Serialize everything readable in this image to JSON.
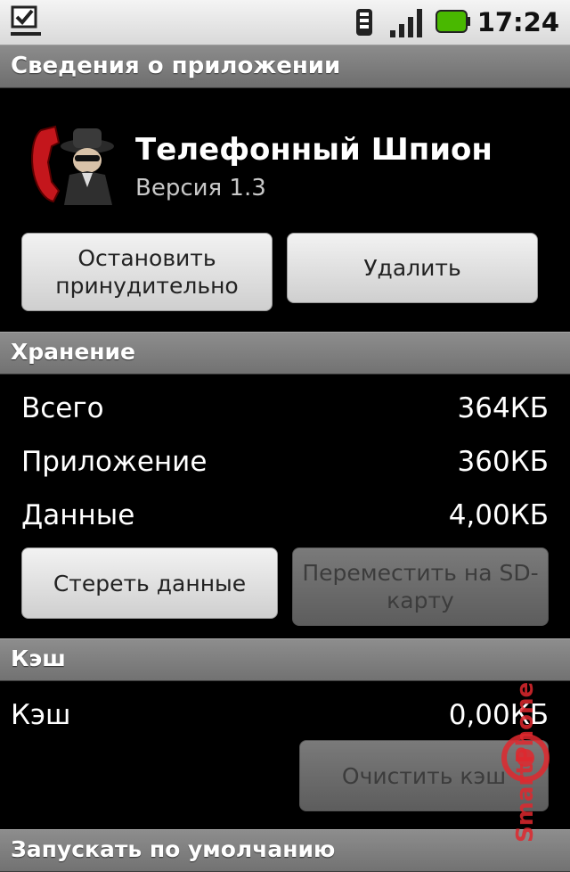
{
  "status_bar": {
    "time": "17:24",
    "icons": [
      "notification-check-icon",
      "wifi-icon",
      "signal-icon",
      "battery-icon"
    ],
    "battery_color": "#49b800"
  },
  "title_bar": {
    "title": "Сведения о приложении"
  },
  "app": {
    "name": "Телефонный Шпион",
    "version": "Версия 1.3",
    "icon": "spy-phone-icon"
  },
  "actions": {
    "force_stop": "Остановить принудительно",
    "uninstall": "Удалить"
  },
  "storage": {
    "header": "Хранение",
    "rows": [
      {
        "label": "Всего",
        "value": "364КБ"
      },
      {
        "label": "Приложение",
        "value": "360КБ"
      },
      {
        "label": "Данные",
        "value": "4,00КБ"
      }
    ],
    "clear_data": "Стереть данные",
    "move_to_sd": "Переместить на SD-карту"
  },
  "cache": {
    "header": "Кэш",
    "label": "Кэш",
    "value": "0,00КБ",
    "clear_cache": "Очистить кэш"
  },
  "launch_default": {
    "header": "Запускать по умолчанию"
  },
  "watermark": {
    "text": "SmartPhone"
  }
}
